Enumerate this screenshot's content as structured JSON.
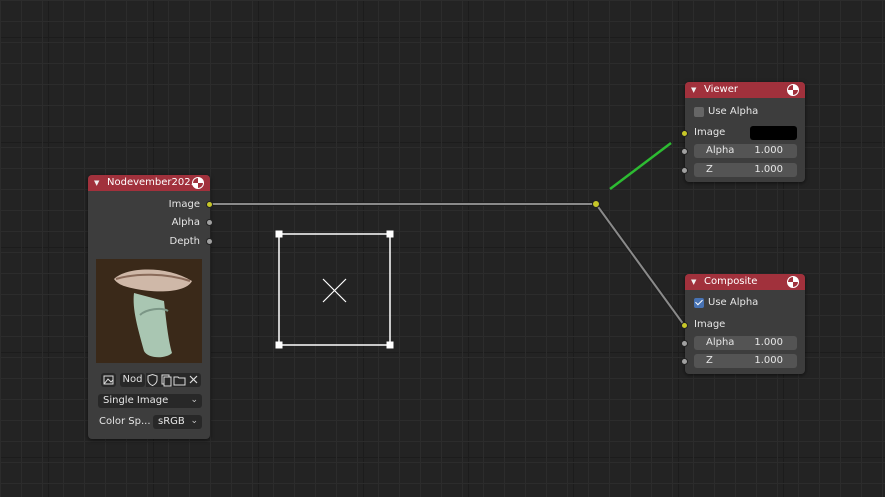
{
  "image_node": {
    "title": "Nodevember202...",
    "outputs": [
      "Image",
      "Alpha",
      "Depth"
    ],
    "image_name": "Nod",
    "source": "Single Image",
    "color_space_label": "Color Sp...",
    "color_space_value": "sRGB"
  },
  "viewer_node": {
    "title": "Viewer",
    "use_alpha_label": "Use Alpha",
    "use_alpha_checked": false,
    "image_label": "Image",
    "alpha_label": "Alpha",
    "alpha_value": "1.000",
    "z_label": "Z",
    "z_value": "1.000"
  },
  "composite_node": {
    "title": "Composite",
    "use_alpha_label": "Use Alpha",
    "use_alpha_checked": true,
    "image_label": "Image",
    "alpha_label": "Alpha",
    "alpha_value": "1.000",
    "z_label": "Z",
    "z_value": "1.000"
  },
  "colors": {
    "background": "#232323",
    "node_header": "#a1313c",
    "node_body": "#3d3d3d",
    "socket_image": "#c7c729",
    "socket_value": "#a1a1a1",
    "link_active": "#2dbb32"
  }
}
